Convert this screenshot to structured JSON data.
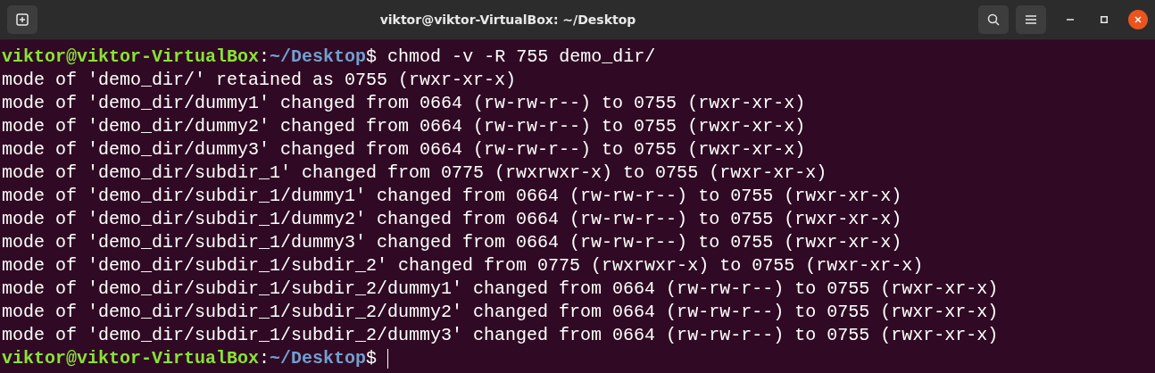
{
  "window": {
    "title": "viktor@viktor-VirtualBox: ~/Desktop"
  },
  "lines": [
    {
      "kind": "prompt",
      "user_host": "viktor@viktor-VirtualBox",
      "separator": ":",
      "path": "~/Desktop",
      "symbol": "$",
      "command": "chmod -v -R 755 demo_dir/",
      "cursor": false
    },
    {
      "kind": "output",
      "text": "mode of 'demo_dir/' retained as 0755 (rwxr-xr-x)"
    },
    {
      "kind": "output",
      "text": "mode of 'demo_dir/dummy1' changed from 0664 (rw-rw-r--) to 0755 (rwxr-xr-x)"
    },
    {
      "kind": "output",
      "text": "mode of 'demo_dir/dummy2' changed from 0664 (rw-rw-r--) to 0755 (rwxr-xr-x)"
    },
    {
      "kind": "output",
      "text": "mode of 'demo_dir/dummy3' changed from 0664 (rw-rw-r--) to 0755 (rwxr-xr-x)"
    },
    {
      "kind": "output",
      "text": "mode of 'demo_dir/subdir_1' changed from 0775 (rwxrwxr-x) to 0755 (rwxr-xr-x)"
    },
    {
      "kind": "output",
      "text": "mode of 'demo_dir/subdir_1/dummy1' changed from 0664 (rw-rw-r--) to 0755 (rwxr-xr-x)"
    },
    {
      "kind": "output",
      "text": "mode of 'demo_dir/subdir_1/dummy2' changed from 0664 (rw-rw-r--) to 0755 (rwxr-xr-x)"
    },
    {
      "kind": "output",
      "text": "mode of 'demo_dir/subdir_1/dummy3' changed from 0664 (rw-rw-r--) to 0755 (rwxr-xr-x)"
    },
    {
      "kind": "output",
      "text": "mode of 'demo_dir/subdir_1/subdir_2' changed from 0775 (rwxrwxr-x) to 0755 (rwxr-xr-x)"
    },
    {
      "kind": "output",
      "text": "mode of 'demo_dir/subdir_1/subdir_2/dummy1' changed from 0664 (rw-rw-r--) to 0755 (rwxr-xr-x)"
    },
    {
      "kind": "output",
      "text": "mode of 'demo_dir/subdir_1/subdir_2/dummy2' changed from 0664 (rw-rw-r--) to 0755 (rwxr-xr-x)"
    },
    {
      "kind": "output",
      "text": "mode of 'demo_dir/subdir_1/subdir_2/dummy3' changed from 0664 (rw-rw-r--) to 0755 (rwxr-xr-x)"
    },
    {
      "kind": "prompt",
      "user_host": "viktor@viktor-VirtualBox",
      "separator": ":",
      "path": "~/Desktop",
      "symbol": "$",
      "cursor": true
    }
  ]
}
